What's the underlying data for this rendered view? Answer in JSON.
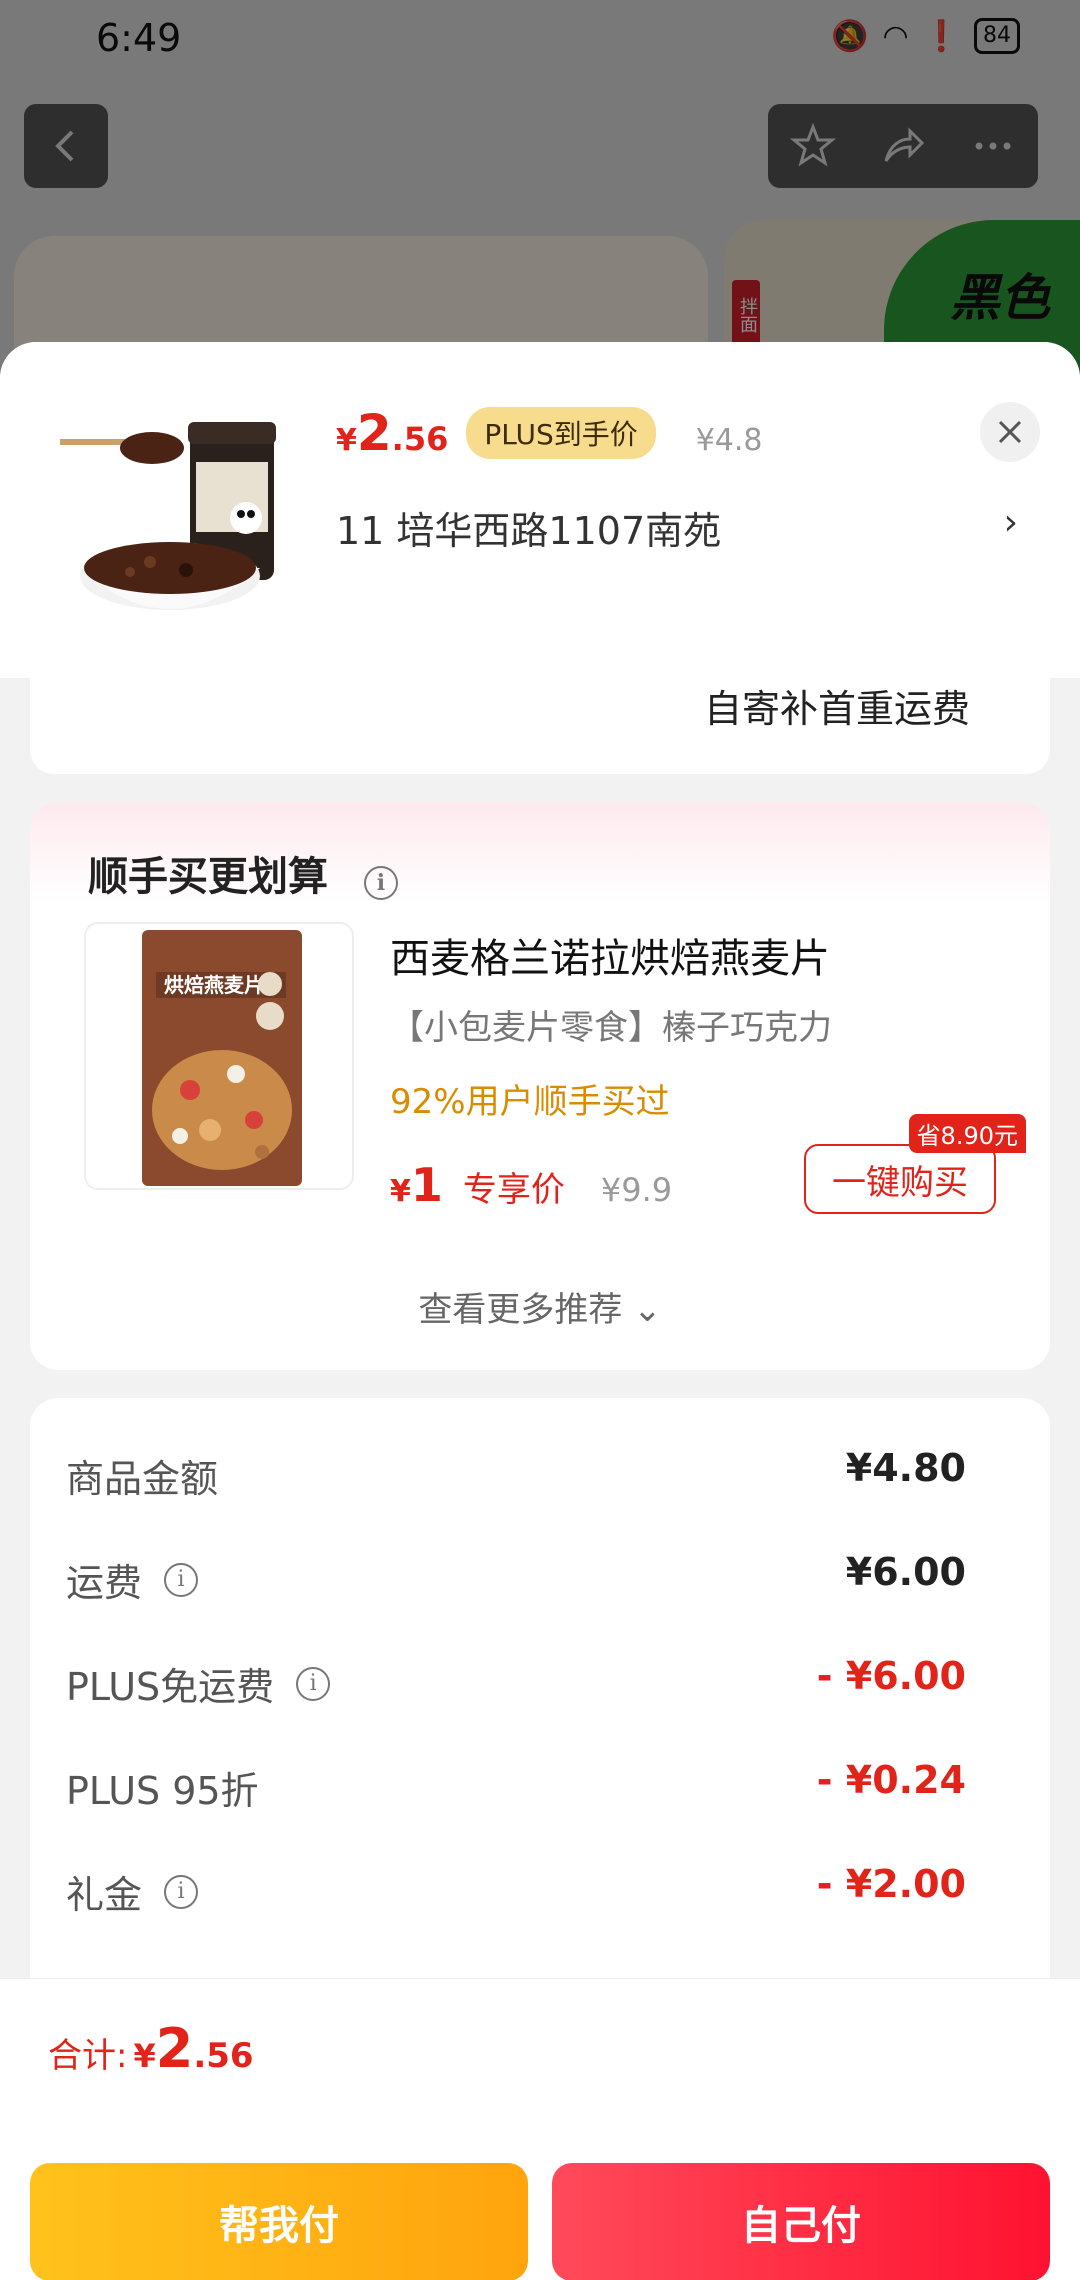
{
  "status_bar": {
    "time": "6:49",
    "battery": "84"
  },
  "background": {
    "green_banner_text": "黑色",
    "tag_text": "拌面"
  },
  "product": {
    "price_yen": "¥",
    "price_int": "2",
    "price_dec": ".56",
    "plus_badge": "PLUS到手价",
    "original_price": "¥4.8",
    "address": "11  培华西路1107南苑"
  },
  "shipping_note": "自寄补首重运费",
  "recommend": {
    "title": "顺手买更划算",
    "item": {
      "name": "西麦格兰诺拉烘焙燕麦片",
      "subtitle": "【小包麦片零食】榛子巧克力",
      "stat": "92%用户顺手买过",
      "price_yen": "¥",
      "price_int": "1",
      "price_tag": "专享价",
      "original_price": "¥9.9",
      "save_badge": "省8.90元",
      "buy_button": "一键购买",
      "package_text": "烘焙燕麦片"
    },
    "more_link": "查看更多推荐 ⌄"
  },
  "costs": [
    {
      "label": "商品金额",
      "value": "¥4.80",
      "info": false,
      "negative": false
    },
    {
      "label": "运费",
      "value": "¥6.00",
      "info": true,
      "negative": false
    },
    {
      "label": "PLUS免运费",
      "value": "- ¥6.00",
      "info": true,
      "negative": true
    },
    {
      "label": "PLUS 95折",
      "value": "- ¥0.24",
      "info": false,
      "negative": true
    },
    {
      "label": "礼金",
      "value": "- ¥2.00",
      "info": true,
      "negative": true
    }
  ],
  "footer": {
    "total_label": "合计:",
    "total_yen": "¥",
    "total_int": "2",
    "total_dec": ".56",
    "help_pay_button": "帮我付",
    "self_pay_button": "自己付"
  },
  "colors": {
    "accent_red": "#e2231a",
    "pill_gold": "#f8dc8d",
    "help_btn": "#ffb514",
    "self_btn": "#ff2a44"
  }
}
